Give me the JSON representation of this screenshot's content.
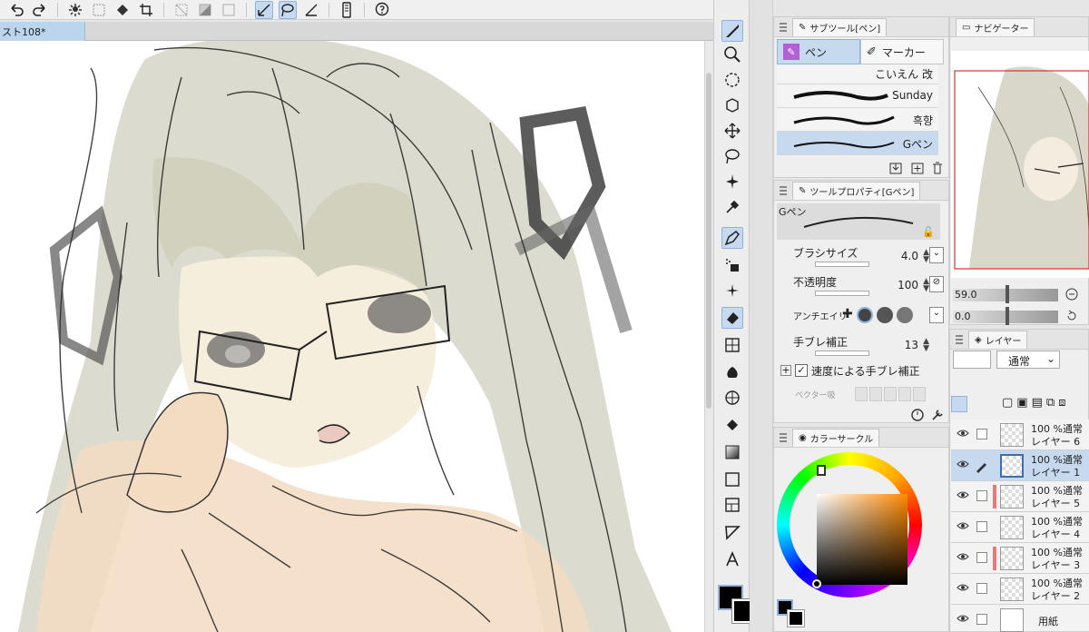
{
  "document": {
    "tab_title": "スト108*"
  },
  "toolbar": {
    "icons": [
      "undo-icon",
      "redo-icon",
      "loading-icon",
      "clear-icon",
      "fill-icon",
      "crop-icon",
      "deselect-icon",
      "invert-icon",
      "grid-icon",
      "pen-selection-icon",
      "lasso-icon",
      "ruler-icon",
      "phone-icon",
      "help-icon"
    ]
  },
  "subtool": {
    "header": "サブツール[ペン]",
    "tabs": [
      {
        "label": "ペン",
        "active": true
      },
      {
        "label": "マーカー",
        "active": false
      }
    ],
    "brushes": [
      {
        "name": "こいえん 改"
      },
      {
        "name": "Sunday"
      },
      {
        "name": "흑향"
      },
      {
        "name": "Gペン",
        "active": true
      }
    ]
  },
  "toolprop": {
    "header": "ツールプロパティ[Gペン]",
    "preview_label": "Gペン",
    "brush_size": {
      "label": "ブラシサイズ",
      "value": "4.0"
    },
    "opacity": {
      "label": "不透明度",
      "value": "100"
    },
    "antialias": {
      "label": "アンチエイリ"
    },
    "stabilization": {
      "label": "手ブレ補正",
      "value": "13"
    },
    "speed_stab": {
      "label": "速度による手ブレ補正",
      "checked": true
    },
    "vector": {
      "label": "ベクター吸"
    }
  },
  "colorwheel": {
    "header": "カラーサークル",
    "main_color": "#000000",
    "sub_color": "#000000"
  },
  "navigator": {
    "header": "ナビゲーター",
    "zoom": "59.0",
    "rotation": "0.0"
  },
  "layers": {
    "header": "レイヤー",
    "blend_mode": "通常",
    "items": [
      {
        "mode": "100 %通常",
        "name": "レイヤー 6",
        "marked": false,
        "active": false,
        "pen": false
      },
      {
        "mode": "100 %通常",
        "name": "レイヤー 1",
        "marked": false,
        "active": true,
        "pen": true
      },
      {
        "mode": "100 %通常",
        "name": "レイヤー 5",
        "marked": true,
        "active": false,
        "pen": false
      },
      {
        "mode": "100 %通常",
        "name": "レイヤー 4",
        "marked": false,
        "active": false,
        "pen": false
      },
      {
        "mode": "100 %通常",
        "name": "レイヤー 3",
        "marked": true,
        "active": false,
        "pen": false
      },
      {
        "mode": "100 %通常",
        "name": "レイヤー 2",
        "marked": false,
        "active": false,
        "pen": false
      },
      {
        "mode": "",
        "name": "用紙",
        "marked": false,
        "active": false,
        "pen": false
      }
    ]
  },
  "tools": [
    "pen-icon",
    "zoom-icon",
    "rotate-icon",
    "object-icon",
    "move-icon",
    "lasso-icon",
    "magic-wand-icon",
    "eyedropper-icon",
    "pen-tool-icon",
    "airbrush-icon",
    "decoration-icon",
    "eraser-icon",
    "shape-icon",
    "blend-icon",
    "figure-icon",
    "ruler-icon",
    "fill-bucket-icon",
    "gradient-icon",
    "frame-icon",
    "panel-icon",
    "balloon-icon",
    "text-icon"
  ]
}
